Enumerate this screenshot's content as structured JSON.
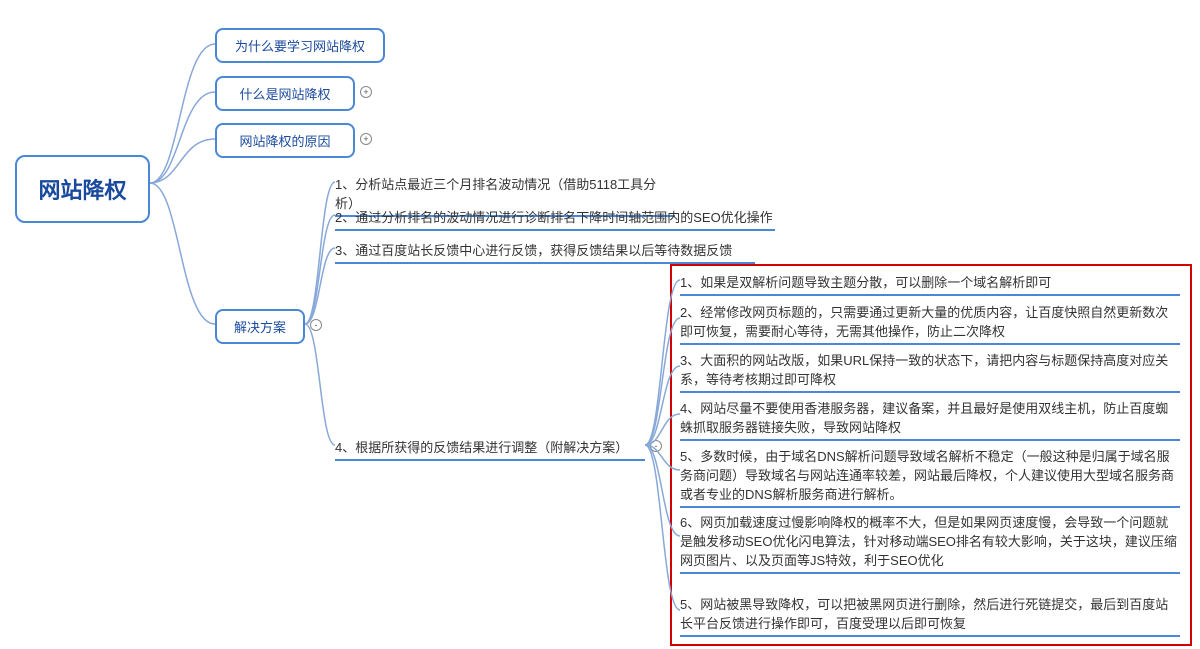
{
  "root": "网站降权",
  "branch1": "为什么要学习网站降权",
  "branch2": "什么是网站降权",
  "branch3": "网站降权的原因",
  "branch4": "解决方案",
  "sol1": "1、分析站点最近三个月排名波动情况（借助5118工具分析）",
  "sol2": "2、通过分析排名的波动情况进行诊断排名下降时间轴范围内的SEO优化操作",
  "sol3": "3、通过百度站长反馈中心进行反馈，获得反馈结果以后等待数据反馈",
  "sol4": "4、根据所获得的反馈结果进行调整（附解决方案）",
  "detail1": "1、如果是双解析问题导致主题分散，可以删除一个域名解析即可",
  "detail2": "2、经常修改网页标题的，只需要通过更新大量的优质内容，让百度快照自然更新数次即可恢复，需要耐心等待，无需其他操作，防止二次降权",
  "detail3": "3、大面积的网站改版，如果URL保持一致的状态下，请把内容与标题保持高度对应关系，等待考核期过即可降权",
  "detail4": "4、网站尽量不要使用香港服务器，建议备案，并且最好是使用双线主机，防止百度蜘蛛抓取服务器链接失败，导致网站降权",
  "detail5": "5、多数时候，由于域名DNS解析问题导致域名解析不稳定（一般这种是归属于域名服务商问题）导致域名与网站连通率较差，网站最后降权，个人建议使用大型域名服务商或者专业的DNS解析服务商进行解析。",
  "detail6": "6、网页加载速度过慢影响降权的概率不大，但是如果网页速度慢，会导致一个问题就是触发移动SEO优化闪电算法，针对移动端SEO排名有较大影响，关于这块，建议压缩网页图片、以及页面等JS特效，利于SEO优化",
  "detail7": "5、网站被黑导致降权，可以把被黑网页进行删除，然后进行死链提交，最后到百度站长平台反馈进行操作即可，百度受理以后即可恢复"
}
